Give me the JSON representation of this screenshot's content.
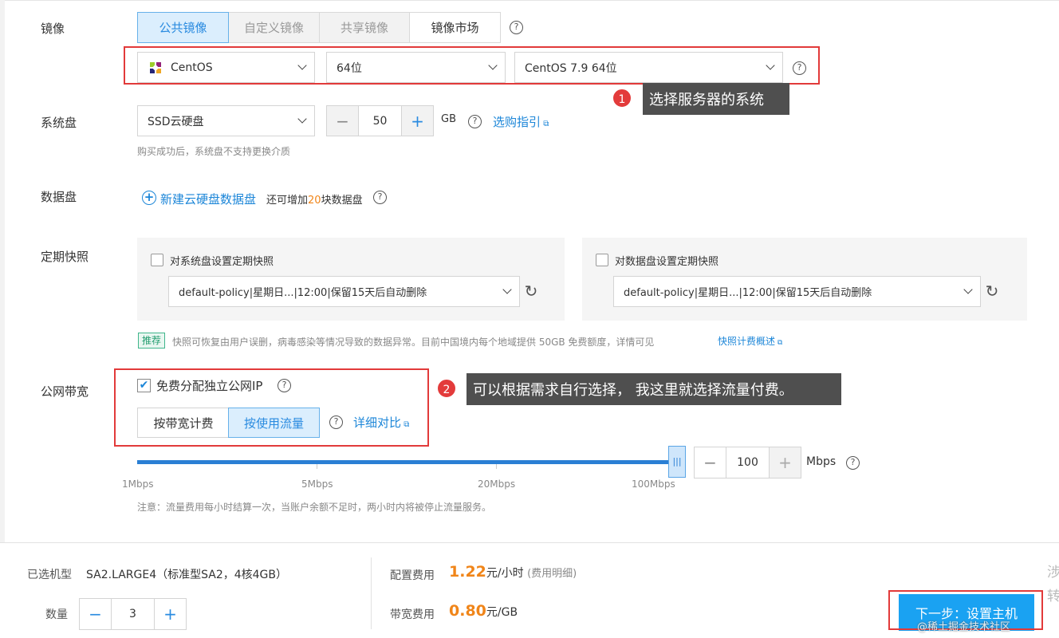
{
  "image": {
    "label": "镜像",
    "tabs": [
      "公共镜像",
      "自定义镜像",
      "共享镜像",
      "镜像市场"
    ],
    "os_select": "CentOS",
    "bits_select": "64位",
    "version_select": "CentOS 7.9 64位",
    "callout_number": "1",
    "callout_text": "选择服务器的系统"
  },
  "system_disk": {
    "label": "系统盘",
    "type": "SSD云硬盘",
    "size": "50",
    "unit": "GB",
    "guide_link": "选购指引",
    "hint": "购买成功后，系统盘不支持更换介质"
  },
  "data_disk": {
    "label": "数据盘",
    "add_link": "新建云硬盘数据盘",
    "extra_prefix": "还可增加",
    "extra_count": "20",
    "extra_suffix": "块数据盘"
  },
  "snapshot": {
    "label": "定期快照",
    "system_checkbox": "对系统盘设置定期快照",
    "system_policy": "default-policy|星期日...|12:00|保留15天后自动删除",
    "data_checkbox": "对数据盘设置定期快照",
    "data_policy": "default-policy|星期日...|12:00|保留15天后自动删除",
    "tag": "推荐",
    "note": "快照可恢复由用户误删，病毒感染等情况导致的数据异常。目前中国境内每个地域提供 50GB 免费额度，详情可见",
    "note_link": "快照计费概述"
  },
  "bandwidth": {
    "label": "公网带宽",
    "free_ip": "免费分配独立公网IP",
    "free_ip_checked": true,
    "mode_bandwidth": "按带宽计费",
    "mode_traffic": "按使用流量",
    "compare_link": "详细对比",
    "callout_number": "2",
    "callout_text": "可以根据需求自行选择，  我这里就选择流量付费。",
    "slider_value": "100",
    "slider_unit": "Mbps",
    "slider_marks": [
      "1Mbps",
      "5Mbps",
      "20Mbps",
      "100Mbps"
    ],
    "slider_fraction": 1.0,
    "note": "注意：流量费用每小时结算一次，当账户余额不足时，两小时内将被停止流量服务。"
  },
  "footer": {
    "selected_label": "已选机型",
    "selected_value": "SA2.LARGE4（标准型SA2，4核4GB）",
    "qty_label": "数量",
    "qty_value": "3",
    "config_fee_label": "配置费用",
    "config_fee_value": "1.22",
    "config_fee_unit": "元/小时",
    "config_fee_link": "(费用明细)",
    "bw_fee_label": "带宽费用",
    "bw_fee_value": "0.80",
    "bw_fee_unit": "元/GB",
    "next_button": "下一步：设置主机",
    "watermark": "@稀土掘金技术社区",
    "side_text": "涉 转"
  },
  "colors": {
    "accent": "#2a8be0",
    "highlight_red": "#e23a3a",
    "price_orange": "#f08519",
    "button_blue": "#1aa2f2"
  }
}
